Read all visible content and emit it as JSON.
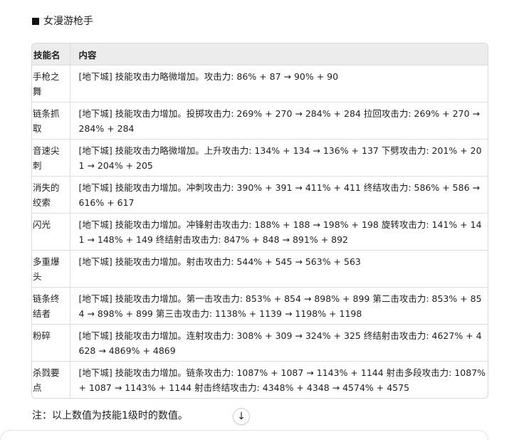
{
  "section": {
    "title": "女漫游枪手"
  },
  "table": {
    "headers": [
      "技能名",
      "内容"
    ],
    "rows": [
      {
        "name": "手枪之舞",
        "content": "[地下城] 技能攻击力略微增加。攻击力: 86% + 87 → 90% + 90"
      },
      {
        "name": "链条抓取",
        "content": "[地下城] 技能攻击力增加。投掷攻击力: 269% + 270 → 284% + 284 拉回攻击力: 269% + 270 → 284% + 284"
      },
      {
        "name": "音速尖刺",
        "content": "[地下城] 技能攻击力略微增加。上升攻击力: 134% + 134 → 136% + 137 下劈攻击力: 201% + 201 → 204% + 205"
      },
      {
        "name": "消失的绞索",
        "content": "[地下城] 技能攻击力增加。冲刺攻击力: 390% + 391 → 411% + 411 终结攻击力: 586% + 586 → 616% + 617"
      },
      {
        "name": "闪光",
        "content": "[地下城] 技能攻击力增加。冲锋射击攻击力: 188% + 188 → 198% + 198 旋转攻击力: 141% + 141 → 148% + 149 终结射击攻击力: 847% + 848 → 891% + 892"
      },
      {
        "name": "多重爆头",
        "content": "[地下城] 技能攻击力增加。射击攻击力: 544% + 545 → 563% + 563"
      },
      {
        "name": "链条终结者",
        "content": "[地下城] 技能攻击力增加。第一击攻击力: 853% + 854 → 898% + 899 第二击攻击力: 853% + 854 → 898% + 899 第三击攻击力: 1138% + 1139 → 1198% + 1198"
      },
      {
        "name": "粉碎",
        "content": "[地下城] 技能攻击力增加。连射攻击力: 308% + 309 → 324% + 325 终结射击攻击力: 4627% + 4628 → 4869% + 4869"
      },
      {
        "name": "杀戮要点",
        "content": "[地下城] 技能攻击力增加。链条攻击力: 1087% + 1087 → 1143% + 1144 射击多段攻击力: 1087% + 1087 → 1143% + 1144 射击终结攻击力: 4348% + 4348 → 4574% + 4575"
      }
    ]
  },
  "note": "注：以上数值为技能1级时的数值。",
  "icons": {
    "scroll_down": "↓"
  }
}
